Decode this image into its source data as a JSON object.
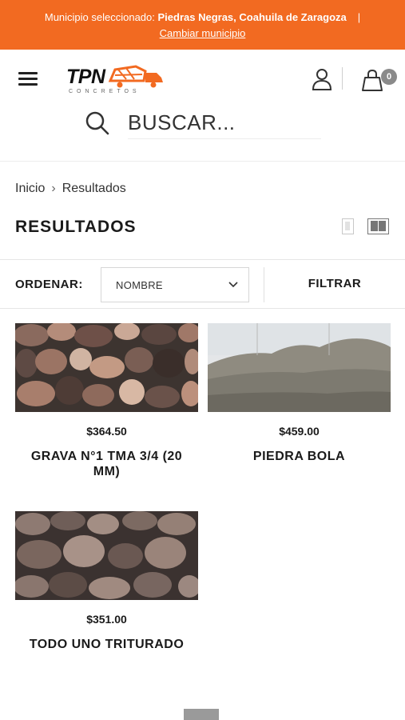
{
  "topbar": {
    "prefix": "Municipio seleccionado: ",
    "municipality": "Piedras Negras, Coahuila de Zaragoza",
    "separator": "|",
    "change_link": "Cambiar municipio"
  },
  "header": {
    "logo_text": "TPN",
    "logo_subtext": "CONCRETOS",
    "cart_count": "0"
  },
  "search": {
    "placeholder": "BUSCAR..."
  },
  "breadcrumb": {
    "items": [
      "Inicio",
      "Resultados"
    ],
    "separator": "›"
  },
  "page": {
    "title": "RESULTADOS"
  },
  "toolbar": {
    "sort_label": "ORDENAR:",
    "sort_value": "NOMBRE",
    "filter_label": "FILTRAR"
  },
  "products": [
    {
      "price": "$364.50",
      "name": "GRAVA N°1 TMA 3/4 (20 MM)"
    },
    {
      "price": "$459.00",
      "name": "PIEDRA BOLA"
    },
    {
      "price": "$351.00",
      "name": "TODO UNO TRITURADO"
    }
  ],
  "colors": {
    "brand_orange": "#f26a21",
    "badge_gray": "#8a8a8a"
  },
  "icons": [
    "hamburger-menu-icon",
    "user-icon",
    "shopping-bag-icon",
    "search-icon",
    "chevron-right-icon",
    "chevron-down-icon",
    "list-view-icon",
    "grid-view-icon"
  ]
}
